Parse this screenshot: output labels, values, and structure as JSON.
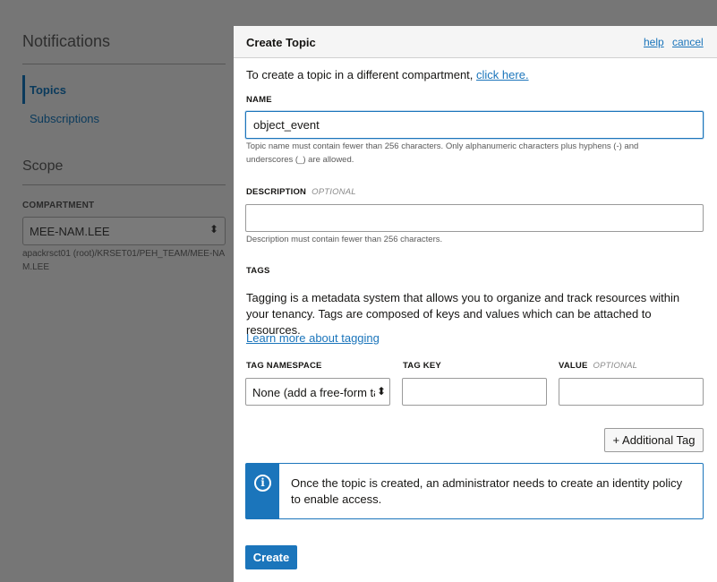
{
  "background": {
    "title": "Notifications",
    "nav_items": [
      {
        "label": "Topics",
        "active": true
      },
      {
        "label": "Subscriptions",
        "active": false
      }
    ],
    "scope_title": "Scope",
    "compartment_label": "COMPARTMENT",
    "compartment_value": "MEE-NAM.LEE",
    "compartment_path": "apackrsct01 (root)/KRSET01/PEH_TEAM/MEE-NAM.LEE"
  },
  "modal": {
    "title": "Create Topic",
    "help_link": "help",
    "cancel_link": "cancel",
    "compartment_note": "To create a topic in a different compartment,",
    "compartment_link": "click here.",
    "name": {
      "label": "NAME",
      "value": "object_event",
      "help": "Topic name must contain fewer than 256 characters. Only alphanumeric characters plus hyphens (-) and underscores (_) are allowed."
    },
    "description": {
      "label": "DESCRIPTION",
      "optional": "OPTIONAL",
      "value": "",
      "help": "Description must contain fewer than 256 characters."
    },
    "tags": {
      "label": "TAGS",
      "intro": "Tagging is a metadata system that allows you to organize and track resources within your tenancy. Tags are composed of keys and values which can be attached to resources.",
      "learn_more": "Learn more about tagging",
      "namespace_label": "TAG NAMESPACE",
      "namespace_value": "None (add a free-form tag)",
      "key_label": "TAG KEY",
      "key_value": "",
      "value_label": "VALUE",
      "value_optional": "OPTIONAL",
      "value_value": "",
      "add_button": "+ Additional Tag"
    },
    "info_message": "Once the topic is created, an administrator needs to create an identity policy to enable access.",
    "create_button": "Create"
  },
  "colors": {
    "accent": "#1b75bb",
    "overlay": "#767676"
  }
}
